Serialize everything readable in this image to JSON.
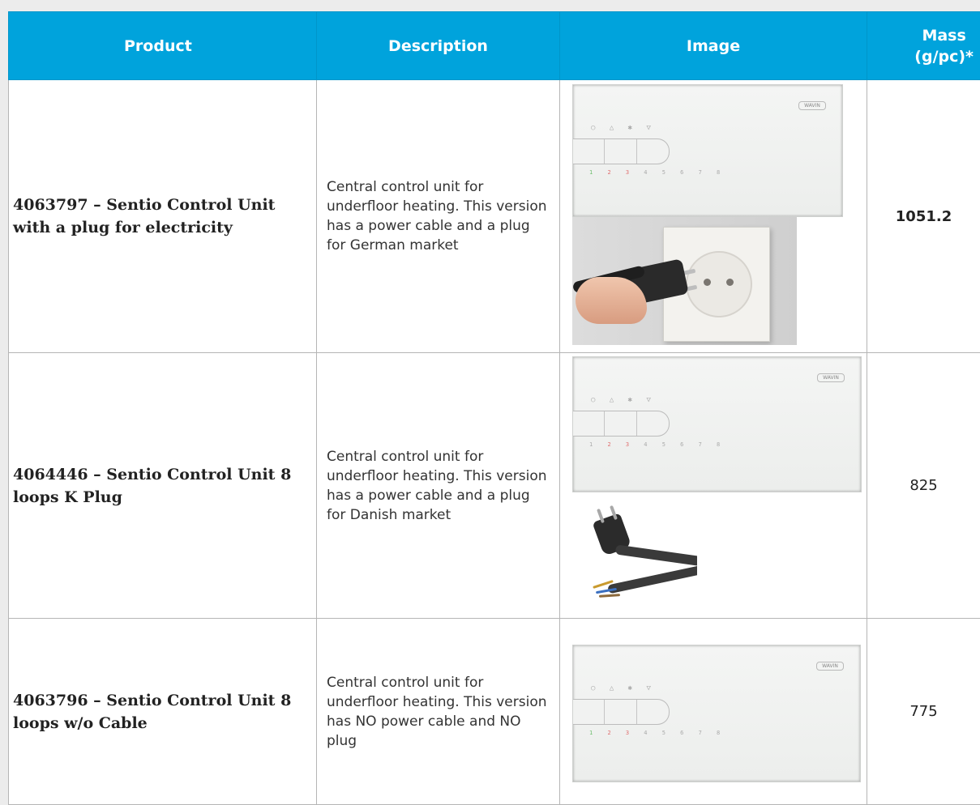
{
  "table": {
    "headers": {
      "product": "Product",
      "description": "Description",
      "image": "Image",
      "mass_line1": "Mass",
      "mass_line2": "(g/pc)*"
    },
    "rows": [
      {
        "product": "4063797 – Sentio Control Unit with a plug for electricity",
        "description": "Central control unit for underfloor heating. This version has a power cable and a plug for German market",
        "mass": "1051.2",
        "images": [
          "control-unit-photo",
          "plug-socket-photo"
        ]
      },
      {
        "product": "4064446 – Sentio Control Unit 8 loops K Plug",
        "description": "Central control unit for underfloor heating. This version has a power cable and a plug for Danish market",
        "mass": "825",
        "images": [
          "control-unit-photo",
          "plug-cable-photo"
        ]
      },
      {
        "product": "4063796 – Sentio Control Unit 8 loops w/o Cable",
        "description": "Central control unit for underfloor heating. This version has NO power cable and NO plug",
        "mass": "775",
        "images": [
          "control-unit-photo"
        ]
      }
    ]
  },
  "device": {
    "brand_badge": "WAVIN",
    "symbols": "○ △ ✱ ▽",
    "leds": "1 2 3 4 5 6 7 8"
  },
  "colors": {
    "header_bg": "#00a3dc",
    "header_text": "#ffffff"
  }
}
